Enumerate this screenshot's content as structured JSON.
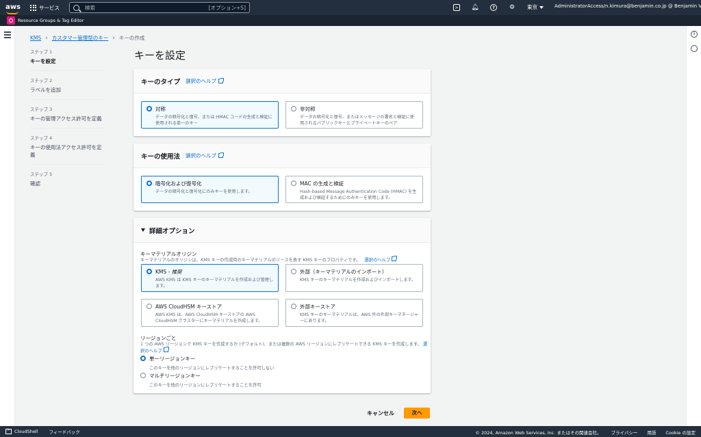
{
  "nav": {
    "services": "サービス",
    "search_placeholder": "検索",
    "search_shortcut": "[オプション+S]",
    "region": "東京",
    "account": "AdministratorAccess/n.kimura@benjamin.co.jp @ Benjamin Verify"
  },
  "favorites": {
    "resource_groups": "Resource Groups & Tag Editor"
  },
  "breadcrumb": {
    "kms": "KMS",
    "cmk": "カスタマー管理型のキー",
    "current": "キーの作成"
  },
  "steps": [
    {
      "label": "ステップ 1",
      "title": "キーを設定"
    },
    {
      "label": "ステップ 2",
      "title": "ラベルを追加"
    },
    {
      "label": "ステップ 3",
      "title": "キーの管理アクセス許可を定義"
    },
    {
      "label": "ステップ 4",
      "title": "キーの使用法アクセス許可を定義"
    },
    {
      "label": "ステップ 5",
      "title": "確認"
    }
  ],
  "page_title": "キーを設定",
  "key_type": {
    "heading": "キーのタイプ",
    "help": "選択のヘルプ",
    "options": [
      {
        "title": "対称",
        "desc": "データの暗号化と復号、または HMAC コードの生成と検証に使用される単一のキー"
      },
      {
        "title": "非対称",
        "desc": "データの暗号化と復号、またはメッセージの署名と検証に使用されるパブリックキーとプライベートキーのペア"
      }
    ]
  },
  "key_usage": {
    "heading": "キーの使用法",
    "help": "選択のヘルプ",
    "options": [
      {
        "title": "暗号化および復号化",
        "desc": "データの暗号化と復号化にのみキーを使用します。"
      },
      {
        "title": "MAC の生成と検証",
        "desc": "Hash-based Message Authentication Code (HMAC) を生成および検証するためにのみキーを使用します。"
      }
    ]
  },
  "advanced": {
    "heading": "詳細オプション",
    "origin_label": "キーマテリアルオリジン",
    "origin_desc": "キーマテリアルのオリジンは、KMS キーの作成時のキーマテリアルのソースを表す KMS キーのプロパティです。",
    "origin_help": "選択のヘルプ",
    "origin_options": [
      {
        "title": "KMS - ",
        "title_em": "推奨",
        "desc": "AWS KMS は KMS キーのキーマテリアルを作成および管理します。"
      },
      {
        "title": "外部（キーマテリアルのインポート）",
        "title_em": "",
        "desc": "KMS キーのキーマテリアルを作成およびインポートします。"
      },
      {
        "title": "AWS CloudHSM キーストア",
        "title_em": "",
        "desc": "AWS KMS は、AWS CloudHSM キーストアの AWS CloudHSM クラスターにキーマテリアルを作成します。"
      },
      {
        "title": "外部キーストア",
        "title_em": "",
        "desc": "KMS キーのキーマテリアルは、AWS 外の外部キーマネージャーにあります。"
      }
    ],
    "region_label": "リージョンごと",
    "region_desc": "1 つの AWS リージョンで KMS キーを作成するか (デフォルト)、または複数の AWS リージョンにレプリケートできる KMS キーを作成します。",
    "region_help": "選択のヘルプ",
    "region_options": [
      {
        "title": "単一リージョンキー",
        "desc": "このキーを他のリージョンにレプリケートすることを許可しない"
      },
      {
        "title": "マルチリージョンキー",
        "desc": "このキーを他のリージョンにレプリケートすることを許可"
      }
    ]
  },
  "actions": {
    "cancel": "キャンセル",
    "next": "次へ"
  },
  "footer": {
    "cloudshell": "CloudShell",
    "feedback": "フィードバック",
    "copyright": "© 2024, Amazon Web Services, Inc. またはその関連会社。",
    "privacy": "プライバシー",
    "terms": "用語",
    "cookie": "Cookie の設定"
  }
}
